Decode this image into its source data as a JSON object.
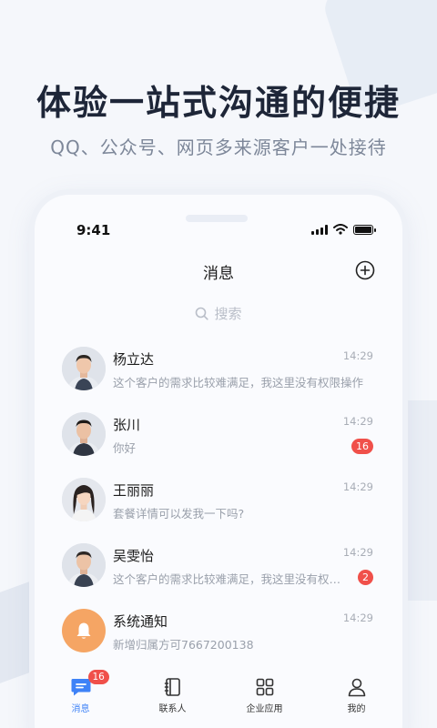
{
  "hero": {
    "headline": "体验一站式沟通的便捷",
    "subline": "QQ、公众号、网页多来源客户一处接待"
  },
  "status_bar": {
    "time": "9:41"
  },
  "nav": {
    "title": "消息",
    "add_icon": "plus-circle-icon"
  },
  "search": {
    "placeholder": "搜索"
  },
  "conversations": [
    {
      "name": "杨立达",
      "preview": "这个客户的需求比较难满足，我这里没有权限操作",
      "time": "14:29",
      "badge": ""
    },
    {
      "name": "张川",
      "preview": "你好",
      "time": "14:29",
      "badge": "16"
    },
    {
      "name": "王丽丽",
      "preview": "套餐详情可以发我一下吗?",
      "time": "14:29",
      "badge": ""
    },
    {
      "name": "吴雯怡",
      "preview": "这个客户的需求比较难满足，我这里没有权限操作",
      "time": "14:29",
      "badge": "2"
    },
    {
      "name": "系统通知",
      "preview": "新增归属方可7667200138",
      "time": "14:29",
      "badge": ""
    }
  ],
  "tabbar": {
    "tabs": [
      {
        "label": "消息",
        "icon": "chat-icon",
        "badge": "16",
        "active": true
      },
      {
        "label": "联系人",
        "icon": "contacts-book-icon"
      },
      {
        "label": "企业应用",
        "icon": "grid-apps-icon"
      },
      {
        "label": "我的",
        "icon": "person-icon"
      }
    ]
  },
  "colors": {
    "accent": "#3e82f7",
    "badge": "#f0504a",
    "notify": "#f5a564"
  }
}
